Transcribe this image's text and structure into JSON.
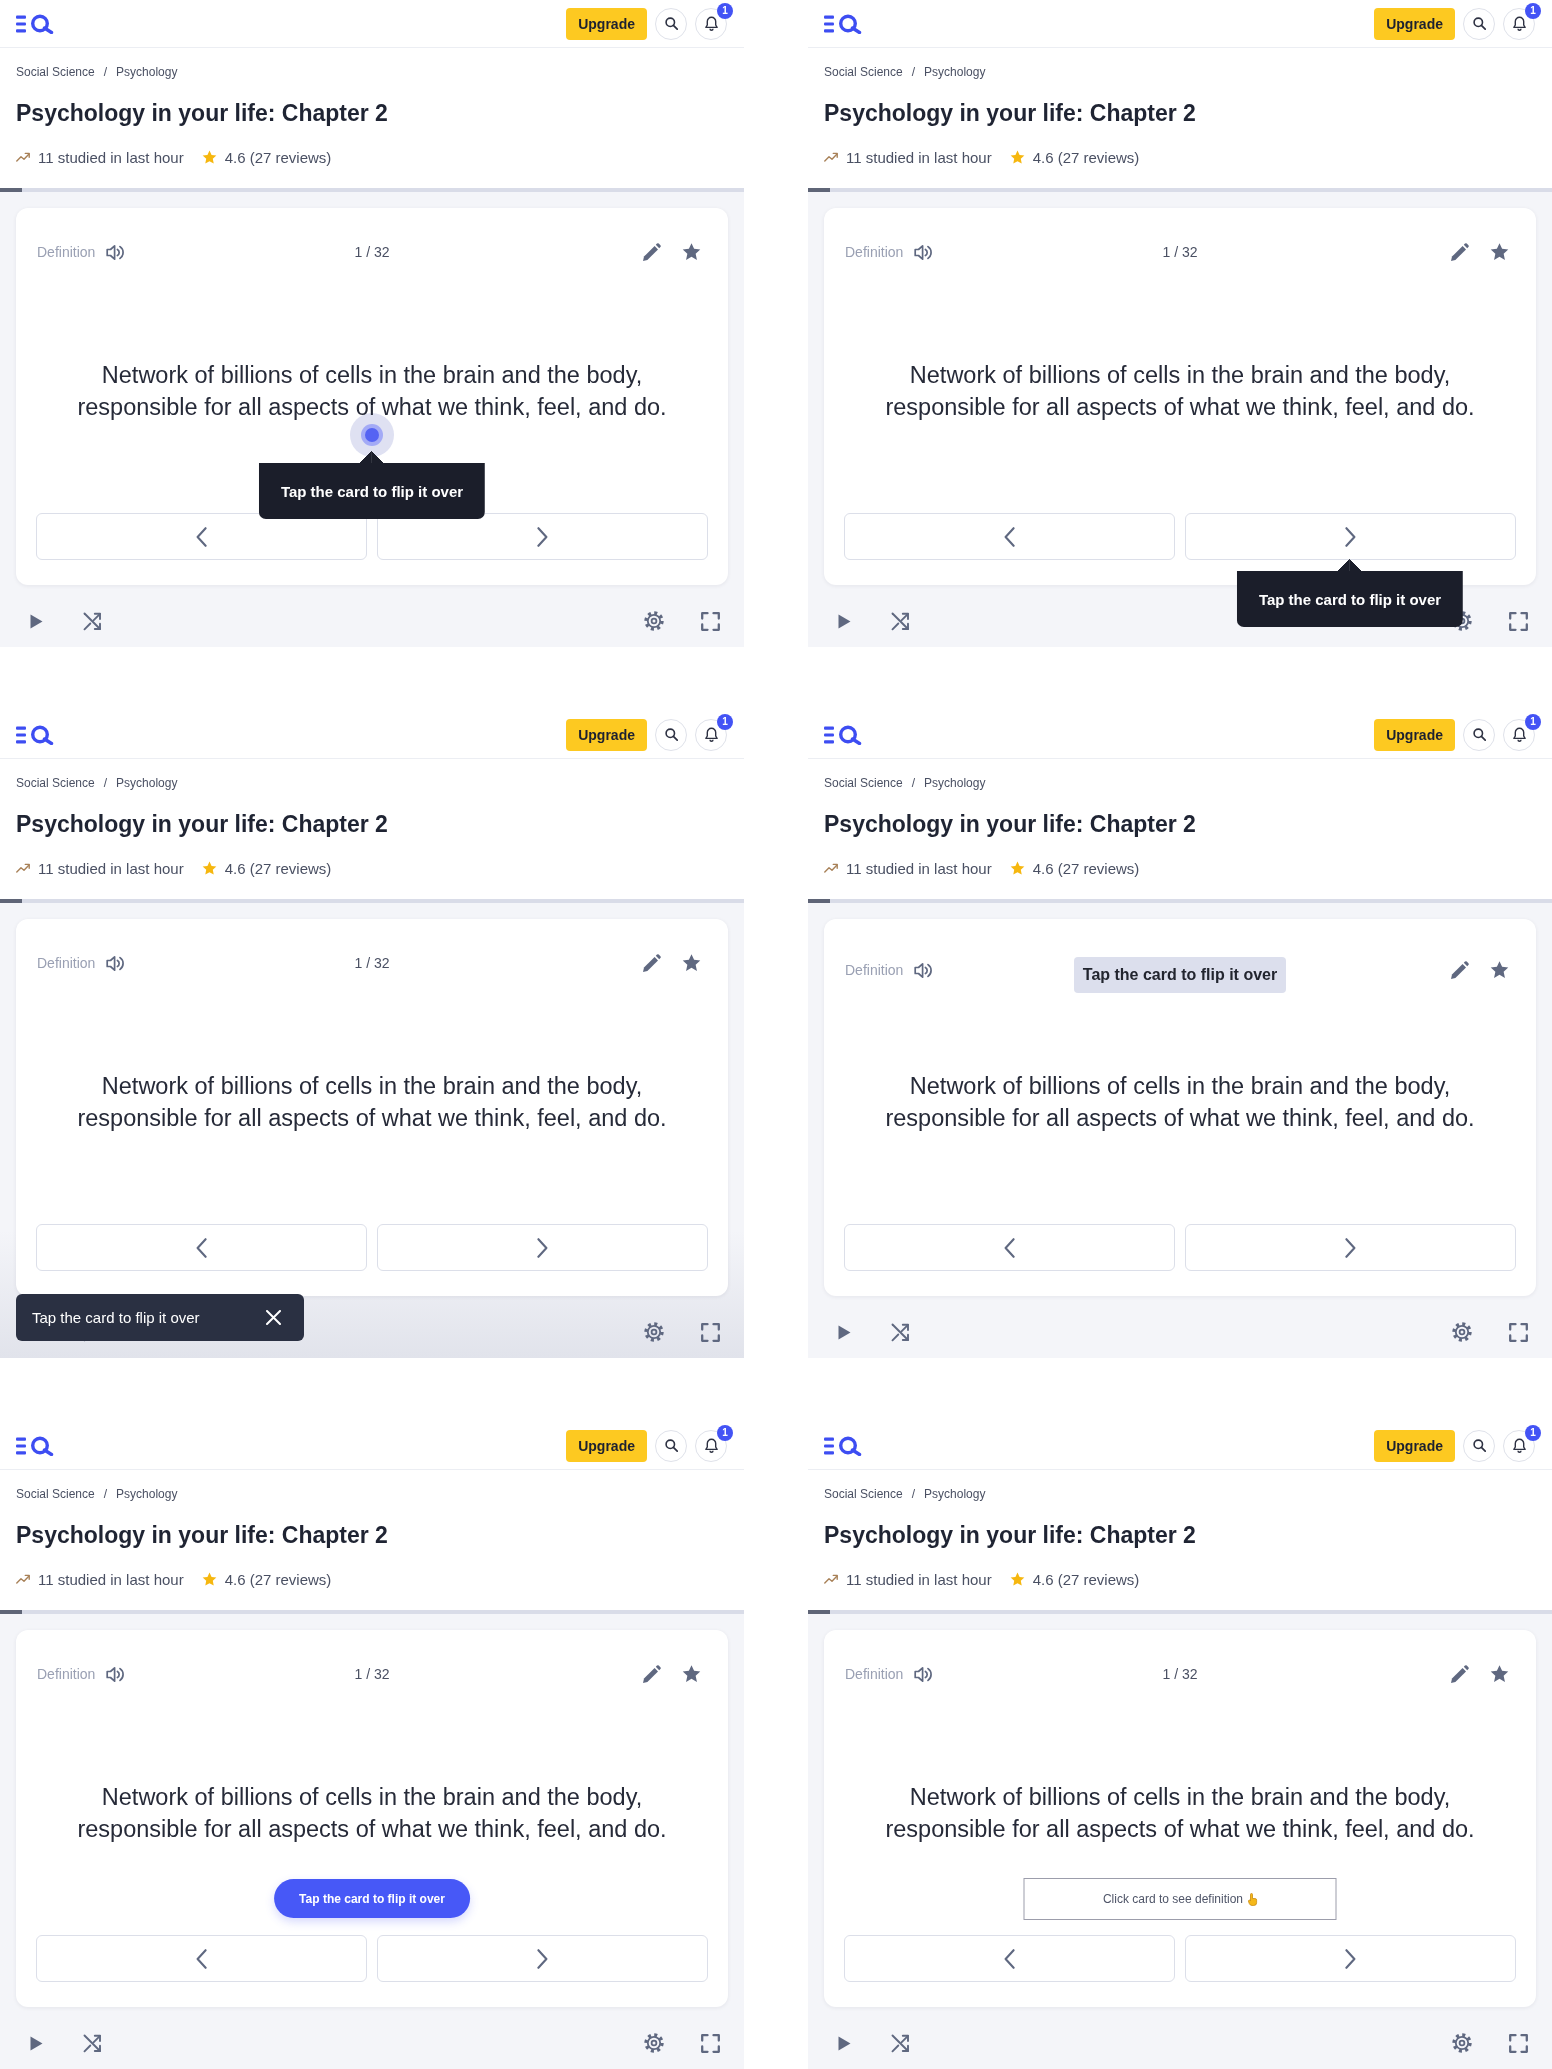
{
  "panels": [
    {
      "header": {
        "upgrade_button": "Upgrade",
        "notification_badge": "1"
      },
      "breadcrumb": {
        "items": [
          "Social Science",
          "Psychology"
        ],
        "separator": "/"
      },
      "title": "Psychology in your life: Chapter 2",
      "stats": {
        "studied": "11 studied in last hour",
        "rating": "4.6 (27 reviews)"
      },
      "progress": {
        "level": 0.03
      },
      "card": {
        "side_label": "Definition",
        "counter": "1 / 32",
        "text": "Network of billions of cells in the brain and the body, responsible for all aspects of what we think, feel, and do."
      },
      "hint": {
        "kind": "tap-tooltip",
        "text": "Tap the card to flip it over"
      }
    },
    {
      "header": {
        "upgrade_button": "Upgrade",
        "notification_badge": "1"
      },
      "breadcrumb": {
        "items": [
          "Social Science",
          "Psychology"
        ],
        "separator": "/"
      },
      "title": "Psychology in your life: Chapter 2",
      "stats": {
        "studied": "11 studied in last hour",
        "rating": "4.6 (27 reviews)"
      },
      "progress": {
        "level": 0.03
      },
      "card": {
        "side_label": "Definition",
        "counter": "1 / 32",
        "text": "Network of billions of cells in the brain and the body, responsible for all aspects of what we think, feel, and do."
      },
      "hint": {
        "kind": "button-tooltip",
        "text": "Tap the card to flip it over"
      }
    },
    {
      "header": {
        "upgrade_button": "Upgrade",
        "notification_badge": "1"
      },
      "breadcrumb": {
        "items": [
          "Social Science",
          "Psychology"
        ],
        "separator": "/"
      },
      "title": "Psychology in your life: Chapter 2",
      "stats": {
        "studied": "11 studied in last hour",
        "rating": "4.6 (27 reviews)"
      },
      "progress": {
        "level": 0.03
      },
      "card": {
        "side_label": "Definition",
        "counter": "1 / 32",
        "text": "Network of billions of cells in the brain and the body, responsible for all aspects of what we think, feel, and do."
      },
      "hint": {
        "kind": "toast",
        "text": "Tap the card to flip it over"
      }
    },
    {
      "header": {
        "upgrade_button": "Upgrade",
        "notification_badge": "1"
      },
      "breadcrumb": {
        "items": [
          "Social Science",
          "Psychology"
        ],
        "separator": "/"
      },
      "title": "Psychology in your life: Chapter 2",
      "stats": {
        "studied": "11 studied in last hour",
        "rating": "4.6 (27 reviews)"
      },
      "progress": {
        "level": 0.03
      },
      "card": {
        "side_label": "Definition",
        "text": "Network of billions of cells in the brain and the body, responsible for all aspects of what we think, feel, and do."
      },
      "hint": {
        "kind": "header-chip",
        "text": "Tap the card to flip it over"
      }
    },
    {
      "header": {
        "upgrade_button": "Upgrade",
        "notification_badge": "1"
      },
      "breadcrumb": {
        "items": [
          "Social Science",
          "Psychology"
        ],
        "separator": "/"
      },
      "title": "Psychology in your life: Chapter 2",
      "stats": {
        "studied": "11 studied in last hour",
        "rating": "4.6 (27 reviews)"
      },
      "progress": {
        "level": 0.03
      },
      "card": {
        "side_label": "Definition",
        "counter": "1 / 32",
        "text": "Network of billions of cells in the brain and the body, responsible for all aspects of what we think, feel, and do."
      },
      "hint": {
        "kind": "pill",
        "text": "Tap the card to flip it over"
      }
    },
    {
      "header": {
        "upgrade_button": "Upgrade",
        "notification_badge": "1"
      },
      "breadcrumb": {
        "items": [
          "Social Science",
          "Psychology"
        ],
        "separator": "/"
      },
      "title": "Psychology in your life: Chapter 2",
      "stats": {
        "studied": "11 studied in last hour",
        "rating": "4.6 (27 reviews)"
      },
      "progress": {
        "level": 0.03
      },
      "card": {
        "side_label": "Definition",
        "counter": "1 / 32",
        "text": "Network of billions of cells in the brain and the body, responsible for all aspects of what we think, feel, and do."
      },
      "hint": {
        "kind": "outlined-prompt",
        "text": "Click card to see definition"
      }
    }
  ]
}
